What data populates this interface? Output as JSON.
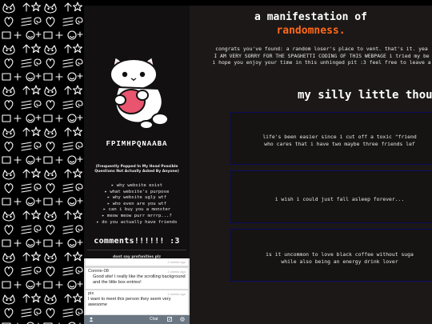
{
  "sidebar": {
    "site_name": "FPIMHPQNAABA",
    "faq_heading": "(Frequently Popped In My Head Possible Questions Not Actually Asked By Anyone)",
    "faq_items": [
      "▸ why website exist",
      "▸ what website's purpose",
      "▸ why website ugly wtf",
      "▸ who even are you wtf",
      "▸ can i buy you a monster",
      "▸ meow meow purr mrrrp...?",
      "▸ do you actually have friends"
    ],
    "comments_heading": "comments!!!!!! :3",
    "comments_note": "dont say profanities plz"
  },
  "comments": [
    {
      "name": "",
      "time": "2 weeks ago",
      "text": ""
    },
    {
      "name": "Connie-08",
      "time": "2 weeks ago",
      "text": "Good site! I really like the scrolling background and the little box entries!"
    },
    {
      "name": "pix",
      "time": "2 weeks ago",
      "text": "I want to meet this person they seem very awesome"
    }
  ],
  "comment_bar": {
    "user_icon": "user-icon",
    "user_label": "Chat",
    "edit_icon": "edit-icon",
    "settings_icon": "settings-icon"
  },
  "main": {
    "title_line1": "a manifestation of",
    "title_line2": "randomness.",
    "intro": [
      "congrats you've found: a random loser's place to vent. that's it. yea",
      "I AM VERY SORRY FOR THE SPAGHETTI CODING OF THIS WEBPAGE i tried my be",
      "i hope you enjoy your time in this unhinged pit :3 feel free to leave a"
    ],
    "section_heading": "my silly little thoug",
    "thoughts": [
      {
        "line1": "life's been easier since i cut off a toxic \"friend",
        "line2": "who cares that i have two maybe three friends lef"
      },
      {
        "line1": "i wish i could just fall asleep forever...",
        "line2": ""
      },
      {
        "line1": "is it uncommon to love black coffee without suga",
        "line2": "while also being an energy drink lover"
      }
    ]
  },
  "colors": {
    "accent": "#ff6a1a",
    "background": "#1c1818",
    "sidebar": "#121011",
    "thought_border": "#0c0c5e",
    "comment_bar": "#6b7683"
  }
}
